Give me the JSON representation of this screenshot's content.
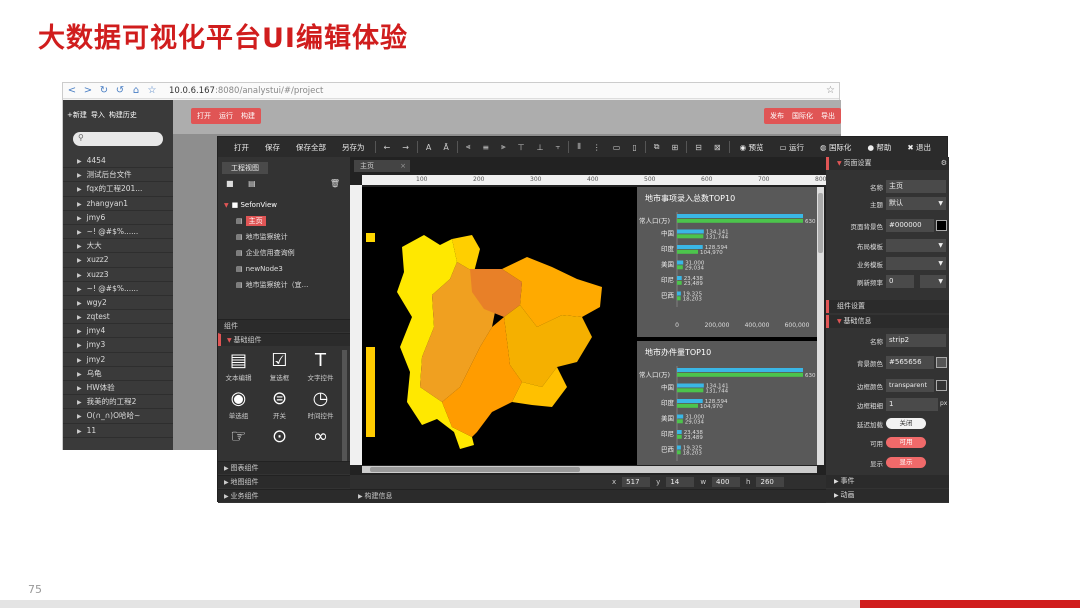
{
  "slide": {
    "title": "大数据可视化平台UI编辑体验",
    "page_number": "75"
  },
  "browser": {
    "url_host": "10.0.6.167",
    "url_rest": ":8080/analystui/#/project",
    "sidebar_buttons": [
      "+新建",
      "导入",
      "构建历史"
    ],
    "projects": [
      "4454",
      "测试后台文件",
      "fqx的工程201...",
      "zhangyan1",
      "jmy6",
      "~! @#$%......",
      "大大",
      "xuzz2",
      "xuzz3",
      "~! @#$%......",
      "wgy2",
      "zqtest",
      "jmy4",
      "jmy3",
      "jmy2",
      "乌龟",
      "HW体验",
      "我美的的工程2",
      "O(∩_∩)O哈哈~",
      "11"
    ],
    "top_left_buttons": [
      "打开",
      "运行",
      "构建"
    ],
    "top_right_buttons": [
      "发布",
      "国际化",
      "导出"
    ]
  },
  "editor": {
    "toolbar": {
      "open": "打开",
      "save": "保存",
      "save_all": "保存全部",
      "save_as": "另存为",
      "preview": "预览",
      "run": "运行",
      "i18n": "国际化",
      "help": "帮助",
      "exit": "退出"
    },
    "left_panel": {
      "tab": "工程视图",
      "tree_root": "SefonView",
      "tree_nodes": [
        {
          "label": "主页",
          "active": true
        },
        {
          "label": "地市监察统计",
          "active": false
        },
        {
          "label": "企业信用查询例",
          "active": false
        },
        {
          "label": "newNode3",
          "active": false
        },
        {
          "label": "地市监察统计（宜...",
          "active": false
        }
      ],
      "section_components": "组件",
      "section_basic": "基础组件",
      "components": [
        {
          "icon": "text-edit-icon",
          "label": "文本编辑"
        },
        {
          "icon": "checkbox-icon",
          "label": "复选框"
        },
        {
          "icon": "text-control-icon",
          "label": "文字控件"
        },
        {
          "icon": "radio-icon",
          "label": "单选组"
        },
        {
          "icon": "toggle-icon",
          "label": "开关"
        },
        {
          "icon": "clock-icon",
          "label": "时间控件"
        },
        {
          "icon": "hand-icon",
          "label": ""
        },
        {
          "icon": "chevron-circle-icon",
          "label": ""
        },
        {
          "icon": "link-icon",
          "label": ""
        }
      ],
      "section_chart": "图表组件",
      "section_map": "地图组件",
      "section_business": "业务组件"
    },
    "canvas": {
      "tab": "主页",
      "ruler_marks": [
        "100",
        "200",
        "300",
        "400",
        "500",
        "600",
        "700",
        "800"
      ],
      "status": {
        "x_label": "x",
        "x": "517",
        "y_label": "y",
        "y": "14",
        "w_label": "w",
        "w": "400",
        "h_label": "h",
        "h": "260"
      },
      "build_info": "构建信息"
    },
    "charts": [
      {
        "title": "地市事项录入总数TOP10",
        "y_axis_label": "常人口(万)",
        "x_ticks": [
          "0",
          "200,000",
          "400,000",
          "600,000"
        ]
      },
      {
        "title": "地市办件量TOP10",
        "y_axis_label": "常人口(万)"
      }
    ],
    "right_panel": {
      "page_settings": "页面设置",
      "name_label": "名称",
      "name_value": "主页",
      "theme_label": "主题",
      "theme_value": "默认",
      "bg_color_label": "页面背景色",
      "bg_color_value": "#000000",
      "layout_template_label": "布局模板",
      "business_template_label": "业务模板",
      "refresh_label": "刷新频率",
      "refresh_value": "0",
      "component_settings": "组件设置",
      "basic_props": "基础信息",
      "comp_name_label": "名称",
      "comp_name_value": "strip2",
      "comp_bg_label": "背景颜色",
      "comp_bg_value": "#565656",
      "border_color_label": "边框颜色",
      "border_color_value": "transparent",
      "border_width_label": "边框粗细",
      "border_width_value": "1",
      "border_width_unit": "px",
      "lazy_load_label": "延迟加载",
      "lazy_load_value": "关闭",
      "enabled_label": "可用",
      "enabled_value": "可用",
      "visible_label": "显示",
      "visible_value": "显示",
      "events": "事件",
      "animation": "动画"
    }
  },
  "chart_data": [
    {
      "type": "bar",
      "title": "地市事项录入总数TOP10",
      "ylabel": "常人口(万)",
      "categories": [
        "",
        "中国",
        "印度",
        "美国",
        "印尼",
        "巴西"
      ],
      "series": [
        {
          "color": "#3ab7e6",
          "values": [
            630000,
            134141,
            128594,
            31000,
            23438,
            19325
          ]
        },
        {
          "color": "#4cc44c",
          "values": [
            630000,
            131744,
            104970,
            29034,
            23489,
            18203
          ]
        }
      ],
      "labels": [
        [
          "",
          ""
        ],
        [
          "134,141",
          "131,744"
        ],
        [
          "128,594",
          "104,970"
        ],
        [
          "31,000",
          "29,034"
        ],
        [
          "23,438",
          "23,489"
        ],
        [
          "19,325",
          "18,203"
        ]
      ],
      "top_label": "630",
      "xlim": [
        0,
        650000
      ]
    },
    {
      "type": "bar",
      "title": "地市办件量TOP10",
      "ylabel": "常人口(万)",
      "categories": [
        "",
        "中国",
        "印度",
        "美国",
        "印尼",
        "巴西"
      ],
      "series": [
        {
          "color": "#3ab7e6",
          "values": [
            630000,
            134141,
            128594,
            31000,
            23438,
            19325
          ]
        },
        {
          "color": "#4cc44c",
          "values": [
            630000,
            131744,
            104970,
            29034,
            23489,
            18203
          ]
        }
      ],
      "labels": [
        [
          "",
          ""
        ],
        [
          "134,141",
          "131,744"
        ],
        [
          "128,594",
          "104,970"
        ],
        [
          "31,000",
          "29,034"
        ],
        [
          "23,438",
          "23,489"
        ],
        [
          "19,325",
          "18,203"
        ]
      ],
      "top_label": "630",
      "xlim": [
        0,
        650000
      ]
    }
  ]
}
